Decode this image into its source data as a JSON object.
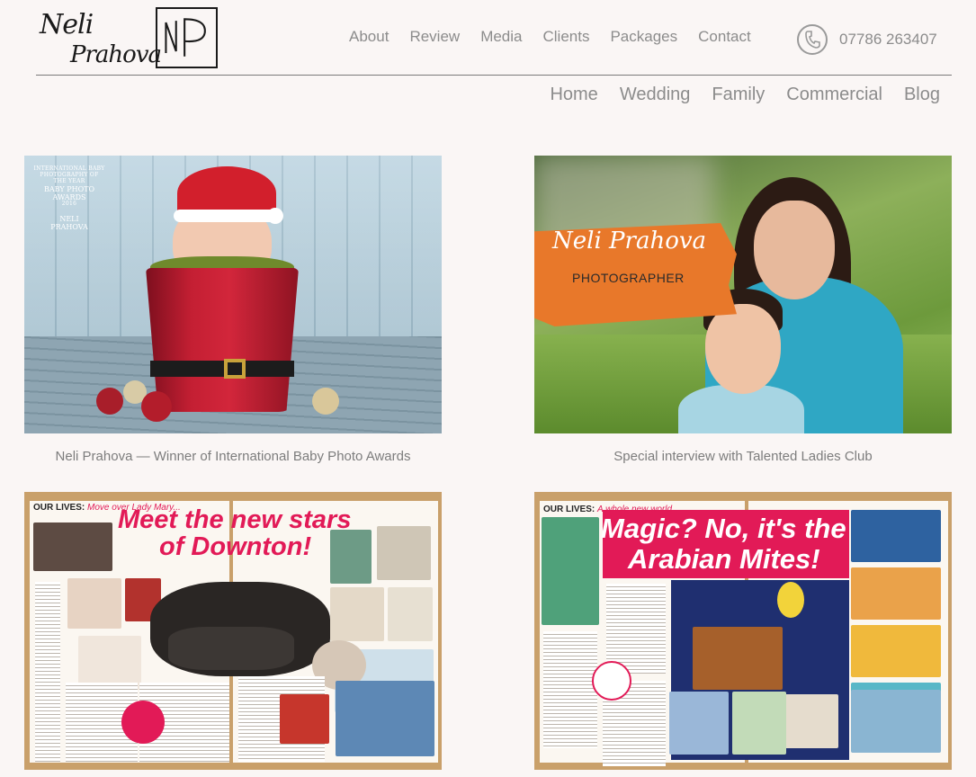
{
  "logo": {
    "script_line1": "Neli",
    "script_line2": "Prahova",
    "monogram": "NP"
  },
  "top_nav": [
    "About",
    "Review",
    "Media",
    "Clients",
    "Packages",
    "Contact"
  ],
  "phone": {
    "number": "07786 263407",
    "icon": "phone-icon"
  },
  "sub_nav": [
    "Home",
    "Wedding",
    "Family",
    "Commercial",
    "Blog"
  ],
  "gallery": [
    {
      "caption": "Neli Prahova — Winner of International Baby Photo Awards",
      "award": {
        "line1": "INTERNATIONAL BABY",
        "line2": "PHOTOGRAPHY OF THE YEAR",
        "title1": "BABY PHOTO",
        "title2": "AWARDS",
        "year": "2016",
        "name1": "NELI",
        "name2": "PRAHOVA"
      }
    },
    {
      "caption": "Special interview with Talented Ladies Club",
      "brush_title": "Neli Prahova",
      "brush_sub": "PHOTOGRAPHER"
    },
    {
      "caption": "",
      "strap": "OUR LIVES:",
      "strap_sub": "Move over Lady Mary...",
      "headline1": "Meet the new stars",
      "headline2": "of Downton!"
    },
    {
      "caption": "",
      "strap": "OUR LIVES:",
      "strap_sub": "A whole new world",
      "headline1": "Magic? No, it's the",
      "headline2": "Arabian Mites!"
    }
  ],
  "colors": {
    "background": "#faf6f5",
    "nav_text": "#8c8c8c",
    "magazine_accent": "#e21a57",
    "brush_orange": "#e8782a"
  }
}
